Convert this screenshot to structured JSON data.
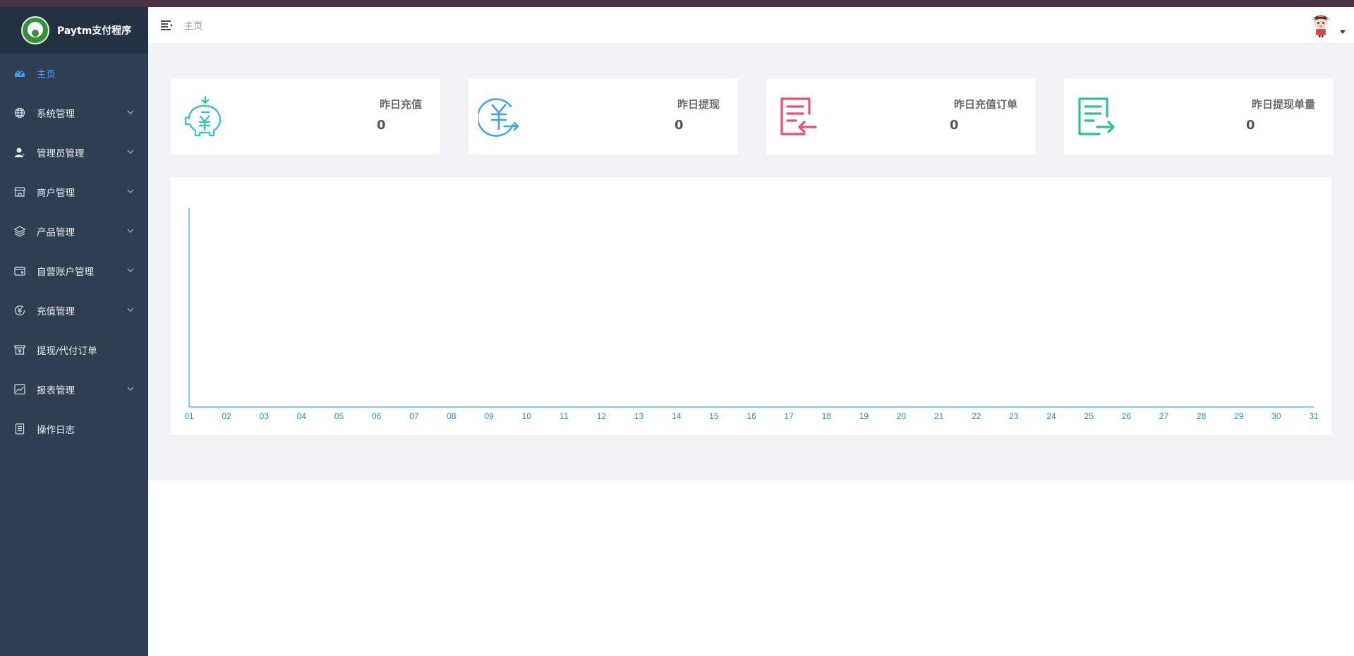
{
  "app": {
    "title": "Paytm支付程序"
  },
  "sidebar": {
    "items": [
      {
        "label": "主页",
        "icon": "dashboard-icon",
        "active": true,
        "expandable": false
      },
      {
        "label": "系统管理",
        "icon": "globe-icon",
        "expandable": true
      },
      {
        "label": "管理员管理",
        "icon": "admin-user-icon",
        "expandable": true
      },
      {
        "label": "商户管理",
        "icon": "store-icon",
        "expandable": true
      },
      {
        "label": "产品管理",
        "icon": "layers-icon",
        "expandable": true
      },
      {
        "label": "自营账户管理",
        "icon": "wallet-icon",
        "expandable": true
      },
      {
        "label": "充值管理",
        "icon": "yen-coin-icon",
        "expandable": true
      },
      {
        "label": "提现/代付订单",
        "icon": "receipt-icon",
        "expandable": false
      },
      {
        "label": "报表管理",
        "icon": "chart-icon",
        "expandable": true
      },
      {
        "label": "操作日志",
        "icon": "log-icon",
        "expandable": false
      }
    ]
  },
  "header": {
    "breadcrumb": "主页",
    "menu_icon": "menu-fold-icon",
    "avatar_icon": "user-avatar-icon"
  },
  "stats": [
    {
      "title": "昨日充值",
      "value": "0",
      "icon": "piggy-bank-icon",
      "color": "#3bc0c3"
    },
    {
      "title": "昨日提现",
      "value": "0",
      "icon": "yen-exchange-icon",
      "color": "#40a3e3"
    },
    {
      "title": "昨日充值订单",
      "value": "0",
      "icon": "order-in-icon",
      "color": "#e9506f"
    },
    {
      "title": "昨日提现单量",
      "value": "0",
      "icon": "order-out-icon",
      "color": "#2fbf9a"
    }
  ],
  "colors": {
    "accent": "#409eff",
    "sidebar": "#2f3e52",
    "chart_axis": "#1f8fd6"
  },
  "chart_data": {
    "type": "line",
    "categories": [
      "01",
      "02",
      "03",
      "04",
      "05",
      "06",
      "07",
      "08",
      "09",
      "10",
      "11",
      "12",
      "13",
      "14",
      "15",
      "16",
      "17",
      "18",
      "19",
      "20",
      "21",
      "22",
      "23",
      "24",
      "25",
      "26",
      "27",
      "28",
      "29",
      "30",
      "31"
    ],
    "series": [
      {
        "values": [
          0,
          0,
          0,
          0,
          0,
          0,
          0,
          0,
          0,
          0,
          0,
          0,
          0,
          0,
          0,
          0,
          0,
          0,
          0,
          0,
          0,
          0,
          0,
          0,
          0,
          0,
          0,
          0,
          0,
          0,
          0
        ]
      }
    ],
    "grid": false,
    "legend": "none"
  }
}
